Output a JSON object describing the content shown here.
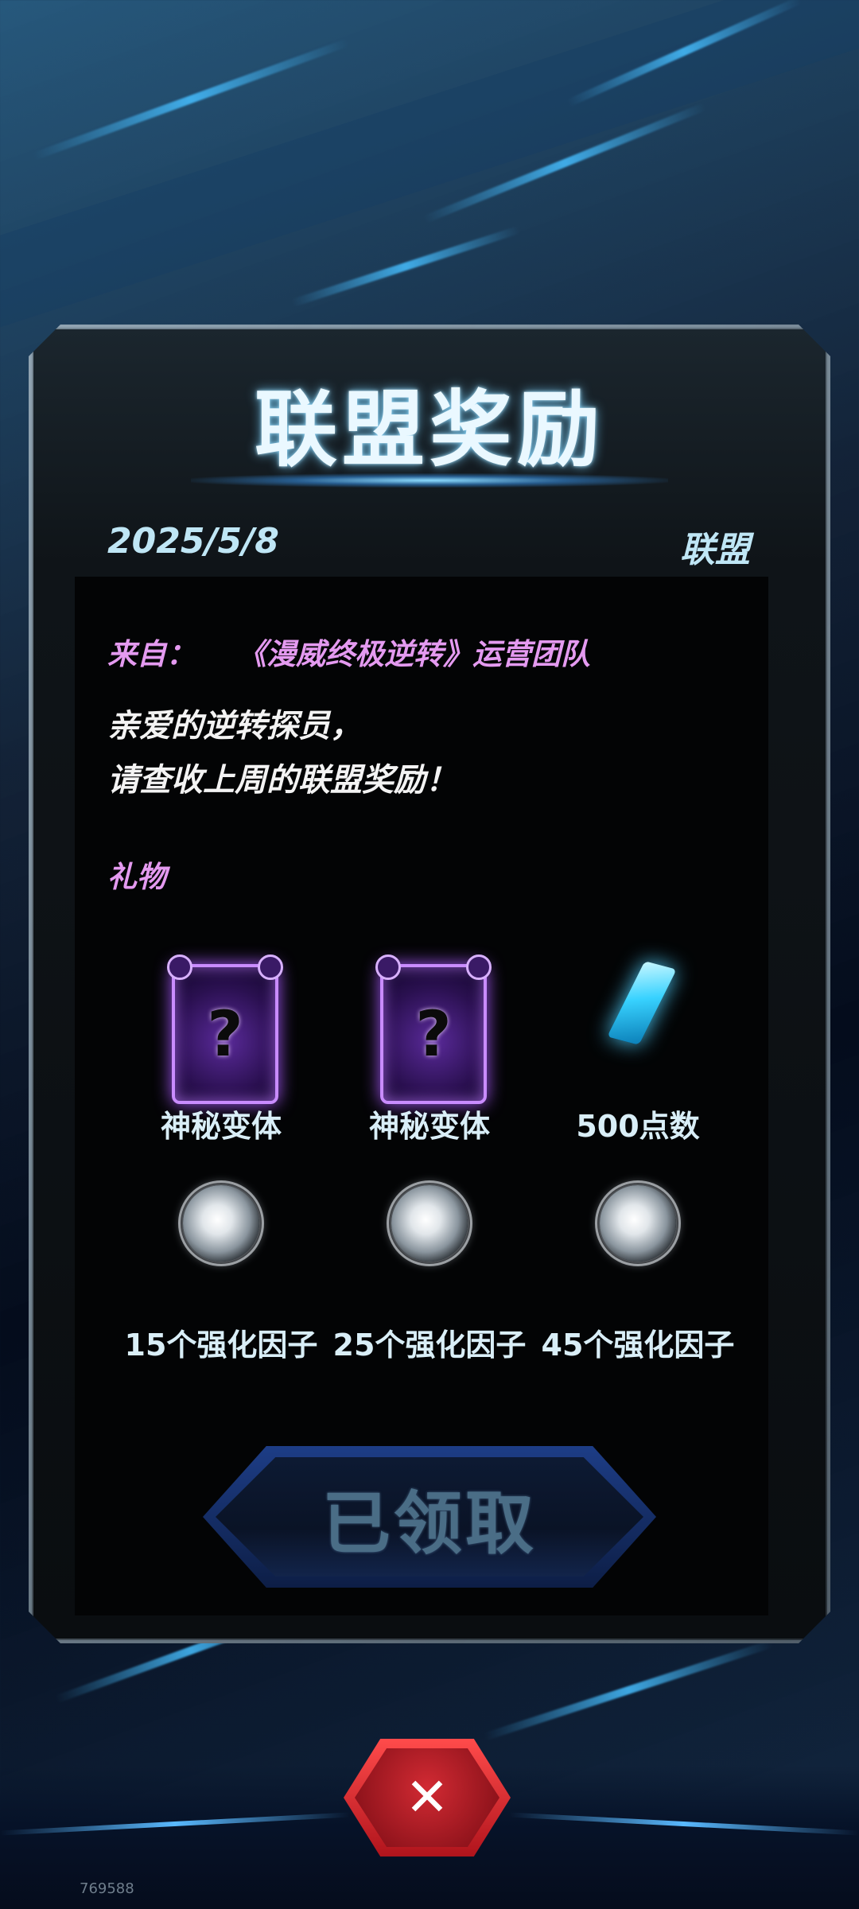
{
  "dialog": {
    "title": "联盟奖励",
    "date": "2025/5/8",
    "category": "联盟"
  },
  "mail": {
    "from_label": "来自：",
    "from_team": "《漫威终极逆转》运营团队",
    "greeting": "亲爱的逆转探员，",
    "body": "请查收上周的联盟奖励！",
    "gifts_label": "礼物"
  },
  "rewards": [
    {
      "label": "神秘变体",
      "icon": "mystery-variant-card-icon"
    },
    {
      "label": "神秘变体",
      "icon": "mystery-variant-card-icon"
    },
    {
      "label": "500点数",
      "icon": "points-crystal-icon"
    },
    {
      "label": "15个强化因子",
      "icon": "boost-factor-orb-icon"
    },
    {
      "label": "25个强化因子",
      "icon": "boost-factor-orb-icon"
    },
    {
      "label": "45个强化因子",
      "icon": "boost-factor-orb-icon"
    }
  ],
  "actions": {
    "claim_label": "已领取",
    "close_icon": "close-icon"
  },
  "watermark": "769588",
  "colors": {
    "accent_pink": "#e49af0",
    "title_text": "#eaf8ff",
    "close_red": "#d22a33",
    "claimed_text": "#4a6d86"
  }
}
